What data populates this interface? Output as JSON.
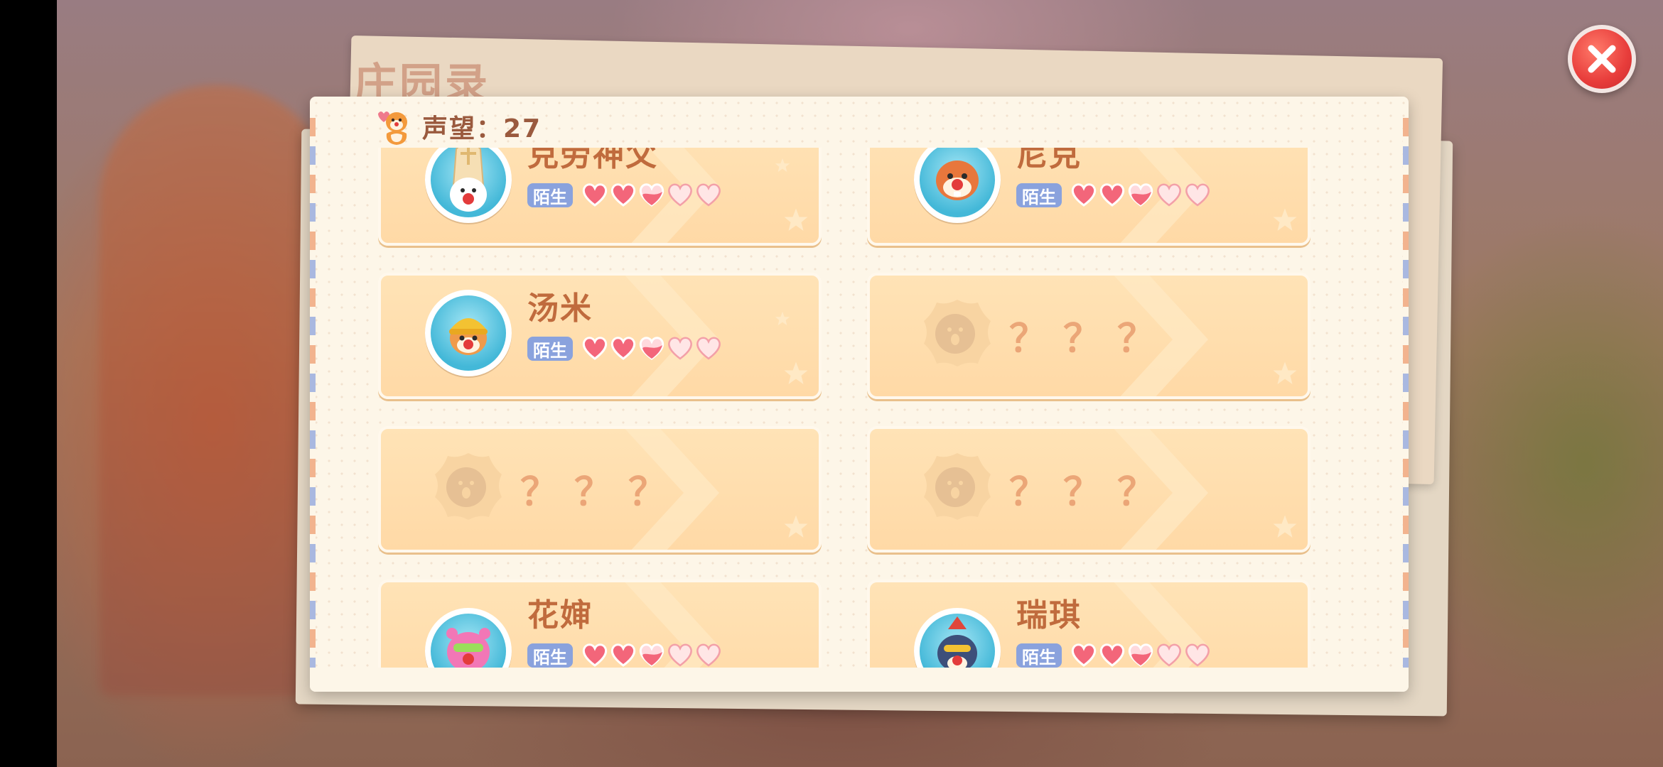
{
  "header": {
    "stamp_title": "庄园录",
    "reputation_label": "声望：27"
  },
  "characters": [
    {
      "name": "克劳神父",
      "relation": "陌生",
      "hearts": [
        "full",
        "full",
        "half",
        "empty",
        "empty"
      ],
      "avatar": "priest-avatar"
    },
    {
      "name": "尼克",
      "relation": "陌生",
      "hearts": [
        "full",
        "full",
        "half",
        "empty",
        "empty"
      ],
      "avatar": "nick-avatar"
    },
    {
      "name": "汤米",
      "relation": "陌生",
      "hearts": [
        "full",
        "full",
        "half",
        "empty",
        "empty"
      ],
      "avatar": "tommy-avatar"
    },
    {
      "name": "？？？",
      "locked": true
    },
    {
      "name": "？？？",
      "locked": true
    },
    {
      "name": "？？？",
      "locked": true
    },
    {
      "name": "花婶",
      "relation": "陌生",
      "hearts": [
        "full",
        "full",
        "half",
        "empty",
        "empty"
      ],
      "avatar": "auntie-hua-avatar"
    },
    {
      "name": "瑞琪",
      "relation": "陌生",
      "hearts": [
        "full",
        "full",
        "half",
        "empty",
        "empty"
      ],
      "avatar": "ricky-avatar"
    }
  ],
  "colors": {
    "accent": "#c06b3d",
    "badge": "#8aa2dd",
    "heart": "#f3667a",
    "card": "#ffdfae",
    "close": "#e83d3b"
  },
  "icons": {
    "close": "close-icon",
    "reputation": "fox-mascot-icon",
    "heart": "heart-icon",
    "locked": "silhouette-icon"
  }
}
